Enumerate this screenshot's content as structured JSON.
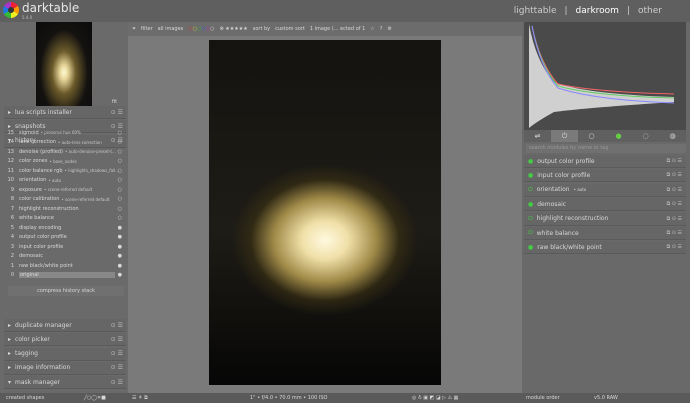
{
  "app": {
    "name": "darktable",
    "version": "5.4.0"
  },
  "views": [
    "lighttable",
    "darkroom",
    "other"
  ],
  "left": {
    "thumb_zoom": "fit",
    "sections_top": [
      {
        "label": "lua scripts installer",
        "expanded": false
      },
      {
        "label": "snapshots",
        "expanded": false
      },
      {
        "label": "history",
        "expanded": true
      }
    ],
    "history": [
      {
        "n": "15",
        "label": "sigmoid",
        "badge": "• preserve hue 60%"
      },
      {
        "n": "14",
        "label": "lens correction",
        "badge": "• auto-lens-correction"
      },
      {
        "n": "13",
        "label": "denoise (profiled)",
        "badge": "• auto-denoise-preset-t..."
      },
      {
        "n": "12",
        "label": "color zones",
        "badge": "• base_nodes"
      },
      {
        "n": "11",
        "label": "color balance rgb",
        "badge": "• highlights_shadows_fall..."
      },
      {
        "n": "10",
        "label": "orientation",
        "badge": "• auto"
      },
      {
        "n": "9",
        "label": "exposure",
        "badge": "• scene-referred default"
      },
      {
        "n": "8",
        "label": "color calibration",
        "badge": "• scene-referred default"
      },
      {
        "n": "7",
        "label": "highlight reconstruction",
        "badge": ""
      },
      {
        "n": "6",
        "label": "white balance",
        "badge": ""
      },
      {
        "n": "5",
        "label": "display encoding",
        "badge": ""
      },
      {
        "n": "4",
        "label": "output color profile",
        "badge": ""
      },
      {
        "n": "3",
        "label": "input color profile",
        "badge": ""
      },
      {
        "n": "2",
        "label": "demosaic",
        "badge": ""
      },
      {
        "n": "1",
        "label": "raw black/white point",
        "badge": ""
      },
      {
        "n": "0",
        "label": "original",
        "badge": ""
      }
    ],
    "compress": "compress history stack",
    "sections_bottom": [
      {
        "label": "duplicate manager",
        "expanded": false
      },
      {
        "label": "color picker",
        "expanded": false
      },
      {
        "label": "tagging",
        "expanded": false
      },
      {
        "label": "image information",
        "expanded": false
      },
      {
        "label": "mask manager",
        "expanded": true
      }
    ]
  },
  "filterbar": {
    "filter_label": "filter",
    "filter_value": "all images",
    "sort_label": "sort by",
    "sort_value": "custom sort",
    "count": "1 image (... ected of 1"
  },
  "bottom": {
    "shapes": "created shapes",
    "exif": "1\" • f/4.0 • 70.0 mm • 100 ISO",
    "module_order_label": "module order",
    "module_order_value": "v5.0 RAW"
  },
  "right": {
    "search_placeholder": "search modules by name or tag",
    "modules": [
      {
        "label": "output color profile",
        "badge": "",
        "on": true
      },
      {
        "label": "input color profile",
        "badge": "",
        "on": true
      },
      {
        "label": "orientation",
        "badge": "• auto",
        "on": false
      },
      {
        "label": "demosaic",
        "badge": "",
        "on": true
      },
      {
        "label": "highlight reconstruction",
        "badge": "",
        "on": false
      },
      {
        "label": "white balance",
        "badge": "",
        "on": false
      },
      {
        "label": "raw black/white point",
        "badge": "",
        "on": true
      }
    ]
  }
}
